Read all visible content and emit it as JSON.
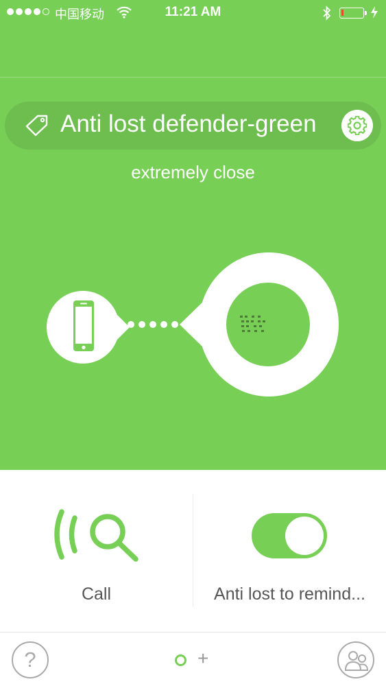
{
  "status_bar": {
    "carrier": "中国移动",
    "time": "11:21 AM",
    "signal_bars_filled": 4,
    "signal_bars_total": 5,
    "battery_level": "low"
  },
  "device": {
    "name": "Anti lost defender-green",
    "distance_text": "extremely close"
  },
  "actions": {
    "call_label": "Call",
    "remind_label": "Anti lost to remind...",
    "remind_enabled": true
  },
  "bottom_bar": {
    "help_label": "?",
    "add_label": "+"
  },
  "colors": {
    "primary_green": "#77cf56",
    "text_gray": "#555555",
    "icon_gray": "#a9a9a9",
    "battery_low": "#e54b2f"
  },
  "icons": [
    "tag-icon",
    "gear-icon",
    "phone-icon",
    "call-search-icon",
    "help-icon",
    "users-icon",
    "wifi-icon",
    "bluetooth-icon",
    "battery-icon"
  ]
}
